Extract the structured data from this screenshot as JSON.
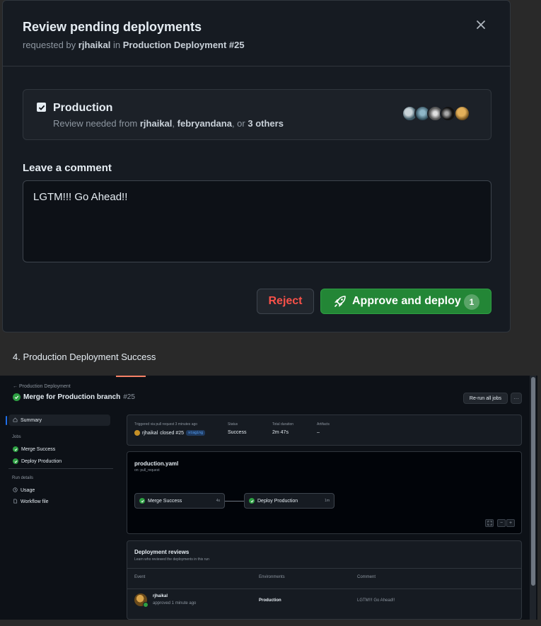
{
  "dialog": {
    "title": "Review pending deployments",
    "subtitle_prefix": "requested by",
    "requester": "rjhaikal",
    "subtitle_in": "in",
    "workflow": "Production Deployment #25",
    "environment": {
      "name": "Production",
      "checked": true,
      "review_prefix": "Review needed from",
      "reviewer1": "rjhaikal",
      "sep": ",",
      "reviewer2": "febryandana",
      "or_text": ", or",
      "others": "3 others"
    },
    "comment_label": "Leave a comment",
    "comment_value": "LGTM!!! Go Ahead!!",
    "reject_label": "Reject",
    "approve_label": "Approve and deploy",
    "approve_count": "1"
  },
  "caption": "4. Production Deployment Success",
  "run": {
    "back_link": "Production Deployment",
    "title": "Merge for Production branch",
    "run_number": "#25",
    "rerun_label": "Re-run all jobs",
    "more_label": "···",
    "sidebar": {
      "summary": "Summary",
      "jobs_heading": "Jobs",
      "jobs": [
        "Merge Success",
        "Deploy Production"
      ],
      "run_details_heading": "Run details",
      "usage": "Usage",
      "workflow_file": "Workflow file"
    },
    "summary": {
      "triggered_label": "Triggered via pull request 3 minutes ago",
      "actor": "rjhaikal",
      "action": "closed #25",
      "branch": "staging",
      "status_label": "Status",
      "status_value": "Success",
      "duration_label": "Total duration",
      "duration_value": "2m 47s",
      "artifacts_label": "Artifacts",
      "artifacts_value": "–"
    },
    "graph": {
      "file": "production.yaml",
      "trigger": "on: pull_request",
      "jobs": [
        {
          "name": "Merge Success",
          "duration": "4s"
        },
        {
          "name": "Deploy Production",
          "duration": "1m"
        }
      ]
    },
    "reviews": {
      "title": "Deployment reviews",
      "subtitle": "Learn who reviewed the deployments in this run",
      "columns": [
        "Event",
        "Environments",
        "Comment"
      ],
      "row": {
        "user": "rjhaikal",
        "event": "approved 1 minute ago",
        "environment": "Production",
        "comment": "LGTM!!! Go Ahead!!"
      }
    }
  },
  "colors": {
    "accent_green": "#238636",
    "danger": "#f85149",
    "dialog_bg": "#161b22",
    "page_bg": "#292929"
  },
  "icons": [
    "close-icon",
    "checkbox-icon",
    "rocket-icon",
    "arrow-left-icon",
    "check-circle-icon",
    "home-icon",
    "clock-icon",
    "file-icon",
    "fullscreen-icon"
  ]
}
